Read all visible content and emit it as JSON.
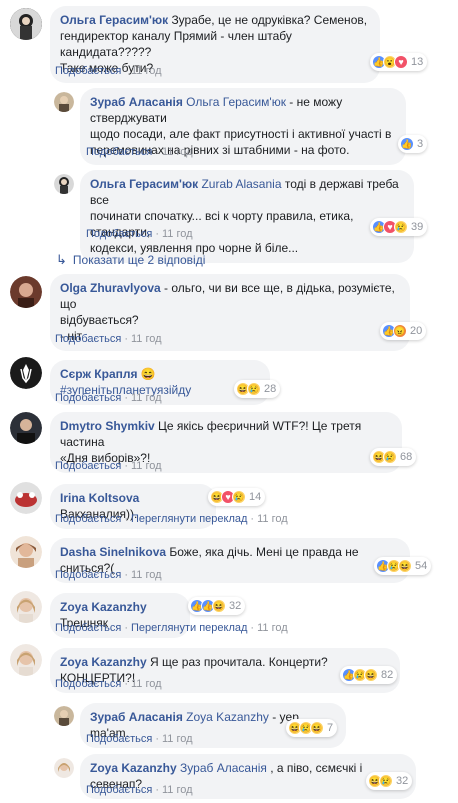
{
  "comments": [
    {
      "author": "Ольга Герасим'юк",
      "text": "Зурабе, це не одрук​івка? Семенов, гендиректор каналу Прямий - член штабу кандидата????? Таке може бути?",
      "line1": "Зурабе, це не одруківка? Семенов,",
      "line2": "гендиректор каналу Прямий - член штабу кандидата?????",
      "line3": "Таке може бути?",
      "like": "Подобається",
      "time": "11 год",
      "reacts": "13"
    },
    {
      "author": "Зураб Аласанія",
      "tag": "Ольга Герасим'юк",
      "line1_rest": " - не можу стверджувати",
      "line2": "щодо посади, але факт присутності і активної участі в",
      "line3": "перемовинах на рівних зі штабними - на фото.",
      "like": "Подобається",
      "time": "11 год",
      "reacts": "3"
    },
    {
      "author": "Ольга Герасим'юк",
      "tag": "Zurab Alasania",
      "line1_rest": " тоді в державі треба все",
      "line2": "починати спочатку... всі к чорту правила, етика, стандарти,",
      "line3": "кодекси, уявлення про чорне й біле...",
      "like": "Подобається",
      "time": "11 год",
      "reacts": "39"
    },
    {
      "more_replies": "Показати ще 2 відповіді"
    },
    {
      "author": "Olga Zhuravlyova",
      "line1_rest": " - ольго, чи ви все ще, в дідька, розумієте, що",
      "line2": "відбувається?",
      "line3": "- ніт",
      "like": "Подобається",
      "time": "11 год",
      "reacts": "20"
    },
    {
      "author": "Сєрж Крапля",
      "emoji": "😄",
      "hashtag": "#зупенітьпланетуязійду",
      "like": "Подобається",
      "time": "11 год",
      "reacts": "28"
    },
    {
      "author": "Dmytro Shymkiv",
      "line1_rest": " Це якісь феєричний WTF?! Це третя частина",
      "line2": "«Дня виборів»?!",
      "like": "Подобається",
      "time": "11 год",
      "reacts": "68"
    },
    {
      "author": "Irina Koltsova",
      "line1_rest": " Вакханалия)).",
      "like": "Подобається",
      "translate": "Переглянути переклад",
      "time": "11 год",
      "reacts": "14"
    },
    {
      "author": "Dasha Sinelnikova",
      "line1_rest": " Боже, яка дічь. Мені це правда не сниться?(",
      "like": "Подобається",
      "time": "11 год",
      "reacts": "54"
    },
    {
      "author": "Zoya Kazanzhy",
      "line1_rest": " Трешняк",
      "like": "Подобається",
      "translate": "Переглянути переклад",
      "time": "11 год",
      "reacts": "32"
    },
    {
      "author": "Zoya Kazanzhy",
      "line1_rest": " Я ще раз прочитала. Концерти? КОНЦЕРТИ?!",
      "like": "Подобається",
      "time": "11 год",
      "reacts": "82"
    },
    {
      "author": "Зураб Аласанія",
      "tag": "Zoya Kazanzhy",
      "line1_rest": " - yep, ma'am.",
      "like": "Подобається",
      "time": "11 год",
      "reacts": "7"
    },
    {
      "author": "Zoya Kazanzhy",
      "tag": "Зураб Аласанія",
      "line1_rest": " , а піво, сємєчкі і севенап?",
      "like": "Подобається",
      "time": "11 год",
      "reacts": "32"
    }
  ],
  "colors": {
    "link": "#385898",
    "bubble": "#f2f3f5",
    "meta": "#90949c",
    "like": "#5890ff",
    "love": "#f25268",
    "haha": "#fcd463"
  },
  "icons": [
    "like-icon",
    "love-icon",
    "haha-icon",
    "wow-icon",
    "sad-icon",
    "angry-icon",
    "reply-arrow-icon"
  ]
}
